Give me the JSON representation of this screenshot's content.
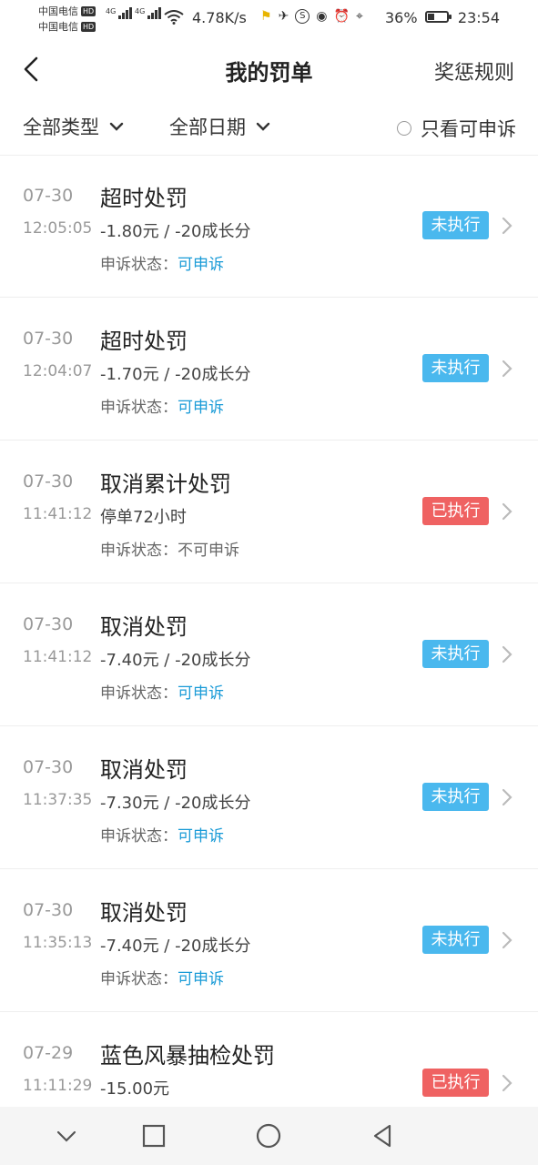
{
  "status_bar": {
    "carrier1": "中国电信",
    "carrier2": "中国电信",
    "hd": "HD",
    "net_type": "4G",
    "speed": "4.78K/s",
    "battery": "36%",
    "battery_level": 0.36,
    "time": "23:54"
  },
  "header": {
    "title": "我的罚单",
    "rules_label": "奖惩规则"
  },
  "filters": {
    "type_label": "全部类型",
    "date_label": "全部日期",
    "only_appealable_label": "只看可申诉"
  },
  "appeal_prefix": "申诉状态：",
  "penalties": [
    {
      "date": "07-30",
      "time": "12:05:05",
      "name": "超时处罚",
      "amount": "-1.80元 / -20成长分",
      "status": "未执行",
      "appeal": "可申诉"
    },
    {
      "date": "07-30",
      "time": "12:04:07",
      "name": "超时处罚",
      "amount": "-1.70元 / -20成长分",
      "status": "未执行",
      "appeal": "可申诉"
    },
    {
      "date": "07-30",
      "time": "11:41:12",
      "name": "取消累计处罚",
      "amount": "停单72小时",
      "status": "已执行",
      "appeal": "不可申诉"
    },
    {
      "date": "07-30",
      "time": "11:41:12",
      "name": "取消处罚",
      "amount": "-7.40元 / -20成长分",
      "status": "未执行",
      "appeal": "可申诉"
    },
    {
      "date": "07-30",
      "time": "11:37:35",
      "name": "取消处罚",
      "amount": "-7.30元 / -20成长分",
      "status": "未执行",
      "appeal": "可申诉"
    },
    {
      "date": "07-30",
      "time": "11:35:13",
      "name": "取消处罚",
      "amount": "-7.40元 / -20成长分",
      "status": "未执行",
      "appeal": "可申诉"
    },
    {
      "date": "07-29",
      "time": "11:11:29",
      "name": "蓝色风暴抽检处罚",
      "amount": "-15.00元",
      "status": "已执行",
      "appeal": ""
    }
  ],
  "colors": {
    "pending_badge": "#4ab8ee",
    "done_badge": "#ef6262",
    "appeal_link": "#1a9bd7"
  }
}
